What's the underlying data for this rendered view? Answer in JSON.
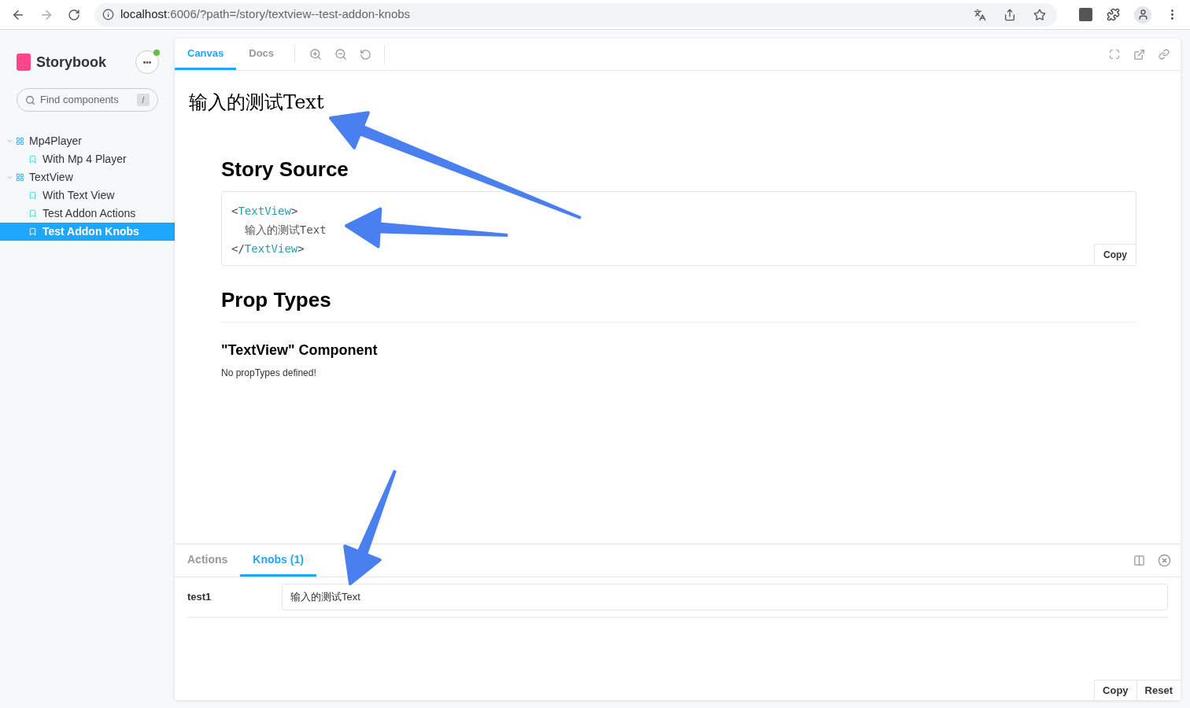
{
  "browser": {
    "url_host": "localhost",
    "url_rest": ":6006/?path=/story/textview--test-addon-knobs"
  },
  "sidebar": {
    "brand": "Storybook",
    "menu_label": "•••",
    "search": {
      "placeholder": "Find components",
      "shortcut": "/"
    },
    "tree": [
      {
        "label": "Mp4Player",
        "kind": "component",
        "expanded": true,
        "selected": false,
        "children": [
          {
            "label": "With Mp 4 Player",
            "kind": "story",
            "selected": false
          }
        ]
      },
      {
        "label": "TextView",
        "kind": "component",
        "expanded": true,
        "selected": false,
        "children": [
          {
            "label": "With Text View",
            "kind": "story",
            "selected": false
          },
          {
            "label": "Test Addon Actions",
            "kind": "story",
            "selected": false
          },
          {
            "label": "Test Addon Knobs",
            "kind": "story",
            "selected": true
          }
        ]
      }
    ]
  },
  "toolbar": {
    "tabs": [
      {
        "label": "Canvas",
        "selected": true
      },
      {
        "label": "Docs",
        "selected": false
      }
    ]
  },
  "preview": {
    "rendered_text": "输入的测试Text",
    "story_source": {
      "title": "Story Source",
      "copy": "Copy",
      "lines": [
        [
          {
            "text": "<",
            "kind": "punct"
          },
          {
            "text": "TextView",
            "kind": "tag"
          },
          {
            "text": ">",
            "kind": "punct"
          }
        ],
        [
          {
            "text": "  输入的测试Text",
            "kind": "text"
          }
        ],
        [
          {
            "text": "</",
            "kind": "punct"
          },
          {
            "text": "TextView",
            "kind": "tag"
          },
          {
            "text": ">",
            "kind": "punct"
          }
        ]
      ]
    },
    "prop_types": {
      "title": "Prop Types",
      "component": "\"TextView\" Component",
      "note": "No propTypes defined!"
    }
  },
  "addons": {
    "tabs": [
      {
        "label": "Actions",
        "selected": false
      },
      {
        "label": "Knobs (1)",
        "selected": true
      }
    ],
    "knobs": [
      {
        "name": "test1",
        "value": "输入的测试Text"
      }
    ],
    "buttons": [
      "Copy",
      "Reset"
    ]
  }
}
